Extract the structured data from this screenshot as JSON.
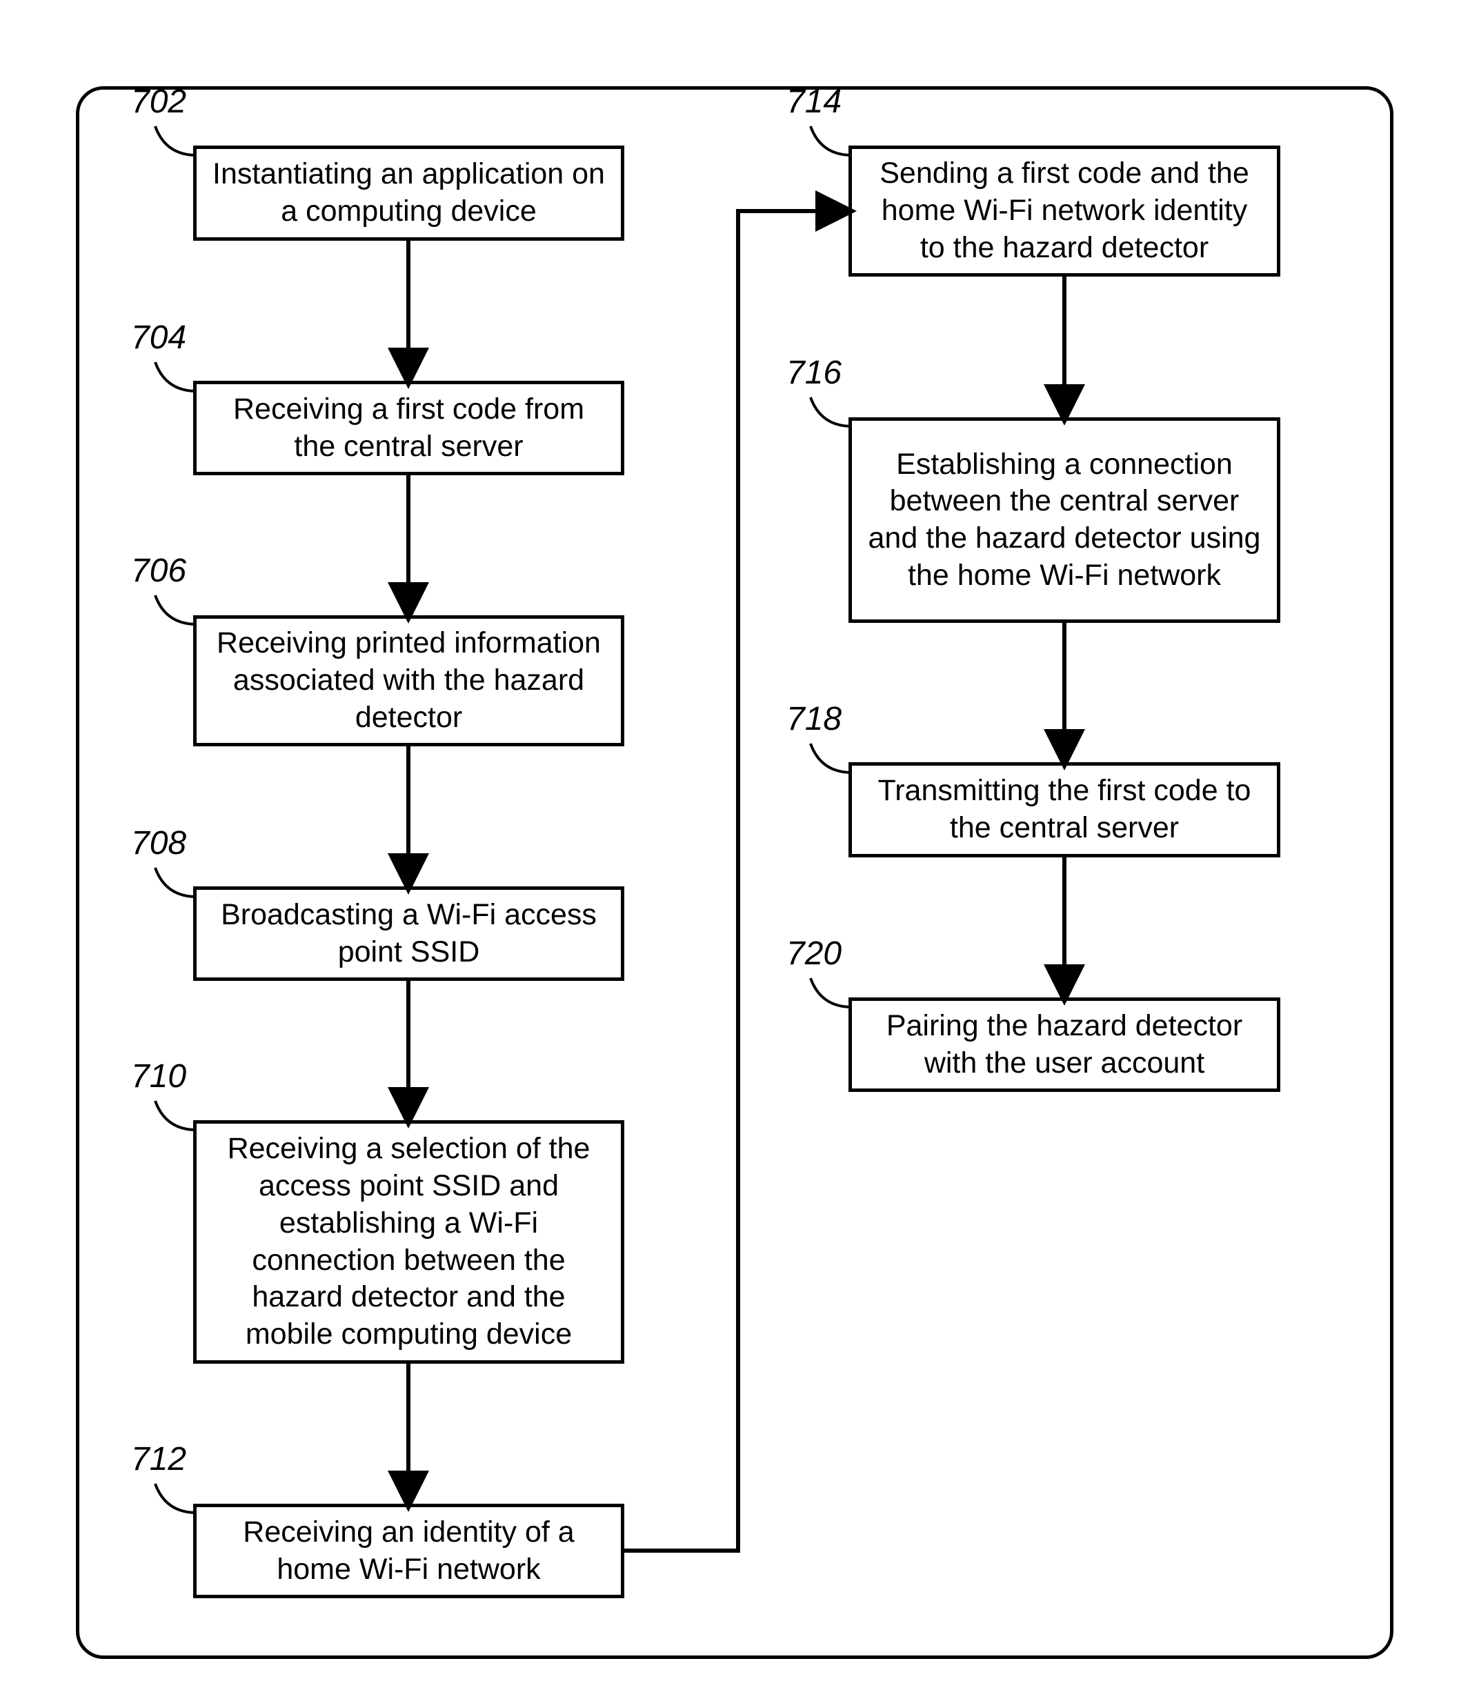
{
  "steps": {
    "s702": {
      "label": "702",
      "text": "Instantiating an application on a computing device"
    },
    "s704": {
      "label": "704",
      "text": "Receiving a first code from the central server"
    },
    "s706": {
      "label": "706",
      "text": "Receiving printed information associated with the hazard detector"
    },
    "s708": {
      "label": "708",
      "text": "Broadcasting a Wi-Fi access point SSID"
    },
    "s710": {
      "label": "710",
      "text": "Receiving a selection of the access point SSID and establishing a Wi-Fi connection between the hazard detector and the mobile computing device"
    },
    "s712": {
      "label": "712",
      "text": "Receiving an identity of a home Wi-Fi network"
    },
    "s714": {
      "label": "714",
      "text": "Sending a first code and the home Wi-Fi network identity to the hazard detector"
    },
    "s716": {
      "label": "716",
      "text": "Establishing a connection between the central server and the hazard detector using the home Wi-Fi network"
    },
    "s718": {
      "label": "718",
      "text": "Transmitting the first code to the central server"
    },
    "s720": {
      "label": "720",
      "text": "Pairing the hazard detector with the user account"
    }
  }
}
